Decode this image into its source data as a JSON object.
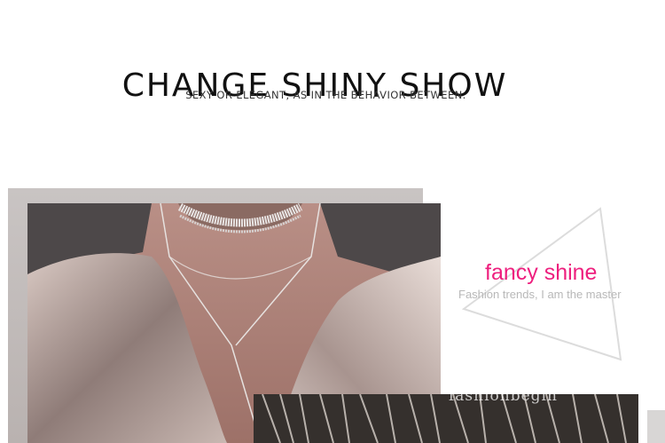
{
  "heading": {
    "title": "CHANGE SHINY SHOW",
    "subtitle": "SEXY OR ELEGANT, AS IN THE BEHAVIOR BETWEEN."
  },
  "feature": {
    "label": "fancy shine",
    "caption": "Fashion trends, I am the master"
  },
  "watermark": "fashionbegin",
  "colors": {
    "accent": "#ee1f7e",
    "caption": "#b8b8b8",
    "title": "#111111"
  },
  "images": [
    {
      "name": "necklace-model-photo",
      "alt": ""
    },
    {
      "name": "fringe-photo",
      "alt": ""
    }
  ]
}
